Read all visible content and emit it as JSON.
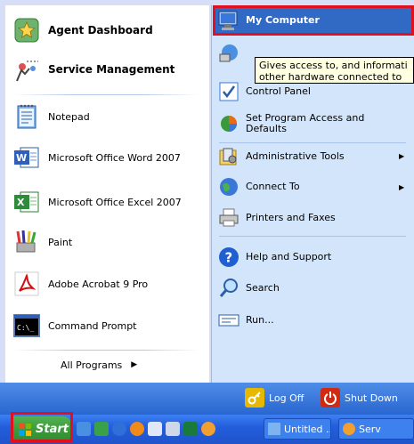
{
  "left_menu": {
    "pinned": [
      {
        "label": "Agent Dashboard",
        "icon": "agent-dashboard-icon"
      },
      {
        "label": "Service Management",
        "icon": "service-management-icon"
      }
    ],
    "recent": [
      {
        "label": "Notepad",
        "icon": "notepad-icon"
      },
      {
        "label": "Microsoft Office Word 2007",
        "icon": "word-icon"
      },
      {
        "label": "Microsoft Office Excel 2007",
        "icon": "excel-icon"
      },
      {
        "label": "Paint",
        "icon": "paint-icon"
      },
      {
        "label": "Adobe Acrobat 9 Pro",
        "icon": "acrobat-icon"
      },
      {
        "label": "Command Prompt",
        "icon": "command-prompt-icon"
      }
    ],
    "all_programs": "All Programs",
    "all_programs_arrow": "▶"
  },
  "right_menu": {
    "my_computer": "My Computer",
    "control_panel": "Control Panel",
    "set_program_access": "Set Program Access and Defaults",
    "administrative_tools": "Administrative Tools",
    "connect_to": "Connect To",
    "printers_and_faxes": "Printers and Faxes",
    "help_and_support": "Help and Support",
    "search": "Search",
    "run": "Run...",
    "submenu_arrow": "▶"
  },
  "tooltip": {
    "line1": "Gives access to, and informati",
    "line2": "other hardware connected to"
  },
  "bottom": {
    "log_off": "Log Off",
    "shut_down": "Shut Down"
  },
  "taskbar": {
    "start": "Start",
    "tasks": [
      "Untitled ...",
      "Serv"
    ]
  },
  "colors": {
    "highlight_red": "#e01020",
    "selection_blue": "#316ac5",
    "taskbar_blue": "#245edc",
    "start_green": "#3c9c3c"
  }
}
